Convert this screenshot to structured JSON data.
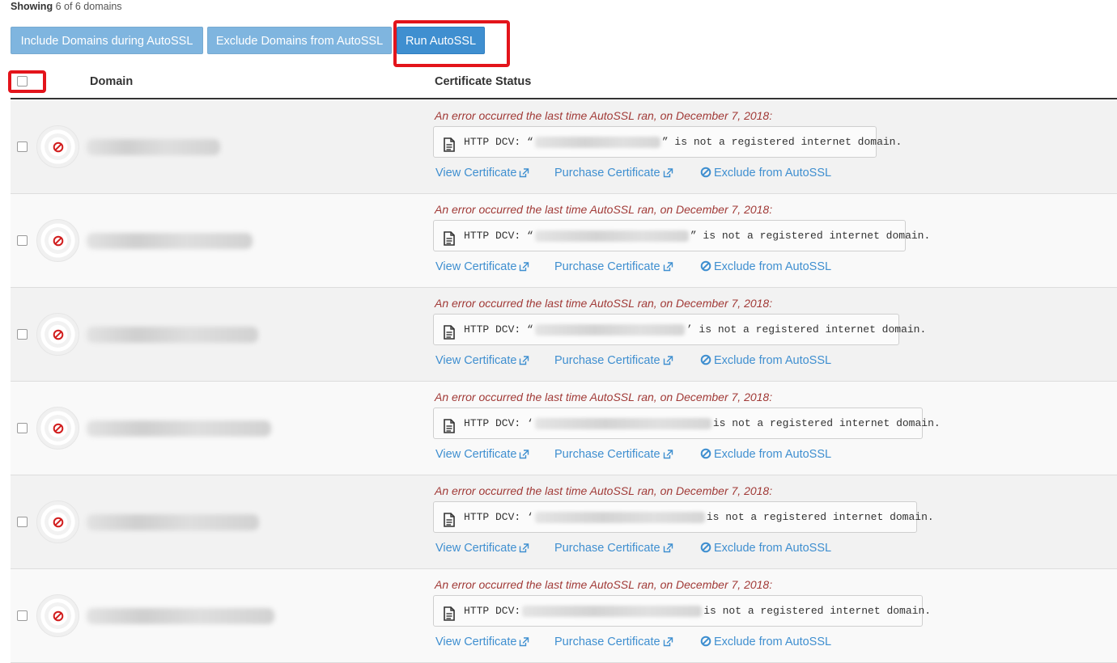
{
  "summary": {
    "label": "Showing",
    "count_text": "6 of 6 domains"
  },
  "toolbar": {
    "include_label": "Include Domains during AutoSSL",
    "exclude_label": "Exclude Domains from AutoSSL",
    "run_label": "Run AutoSSL"
  },
  "table": {
    "col_domain": "Domain",
    "col_status": "Certificate Status"
  },
  "rows": [
    {
      "error_text": "An error occurred the last time AutoSSL ran, on December 7, 2018:",
      "dcv_prefix": "HTTP DCV: “",
      "dcv_suffix": "” is not a registered internet domain.",
      "view_label": "View Certificate",
      "purchase_label": "Purchase Certificate",
      "exclude_label": "Exclude from AutoSSL"
    },
    {
      "error_text": "An error occurred the last time AutoSSL ran, on December 7, 2018:",
      "dcv_prefix": "HTTP DCV: “",
      "dcv_suffix": "” is not a registered internet domain.",
      "view_label": "View Certificate",
      "purchase_label": "Purchase Certificate",
      "exclude_label": "Exclude from AutoSSL"
    },
    {
      "error_text": "An error occurred the last time AutoSSL ran, on December 7, 2018:",
      "dcv_prefix": "HTTP DCV: “",
      "dcv_suffix": "’ is not a registered internet domain.",
      "view_label": "View Certificate",
      "purchase_label": "Purchase Certificate",
      "exclude_label": "Exclude from AutoSSL"
    },
    {
      "error_text": "An error occurred the last time AutoSSL ran, on December 7, 2018:",
      "dcv_prefix": "HTTP DCV: ‘",
      "dcv_suffix": "is not a registered internet domain.",
      "view_label": "View Certificate",
      "purchase_label": "Purchase Certificate",
      "exclude_label": "Exclude from AutoSSL"
    },
    {
      "error_text": "An error occurred the last time AutoSSL ran, on December 7, 2018:",
      "dcv_prefix": "HTTP DCV: ‘",
      "dcv_suffix": "is not a registered internet domain.",
      "view_label": "View Certificate",
      "purchase_label": "Purchase Certificate",
      "exclude_label": "Exclude from AutoSSL"
    },
    {
      "error_text": "An error occurred the last time AutoSSL ran, on December 7, 2018:",
      "dcv_prefix": "HTTP DCV:",
      "dcv_suffix": "is not a registered internet domain.",
      "view_label": "View Certificate",
      "purchase_label": "Purchase Certificate",
      "exclude_label": "Exclude from AutoSSL"
    }
  ],
  "colors": {
    "link": "#3f8fd0",
    "error": "#a13a37",
    "button_primary": "#3f8fd0",
    "button_light": "#7fb5df",
    "highlight": "#e3141b",
    "status_icon": "#d21f1f"
  },
  "icons": {
    "status": "ban-icon",
    "dcv": "file-text-icon",
    "external": "external-link-icon",
    "exclude": "ban-icon"
  }
}
